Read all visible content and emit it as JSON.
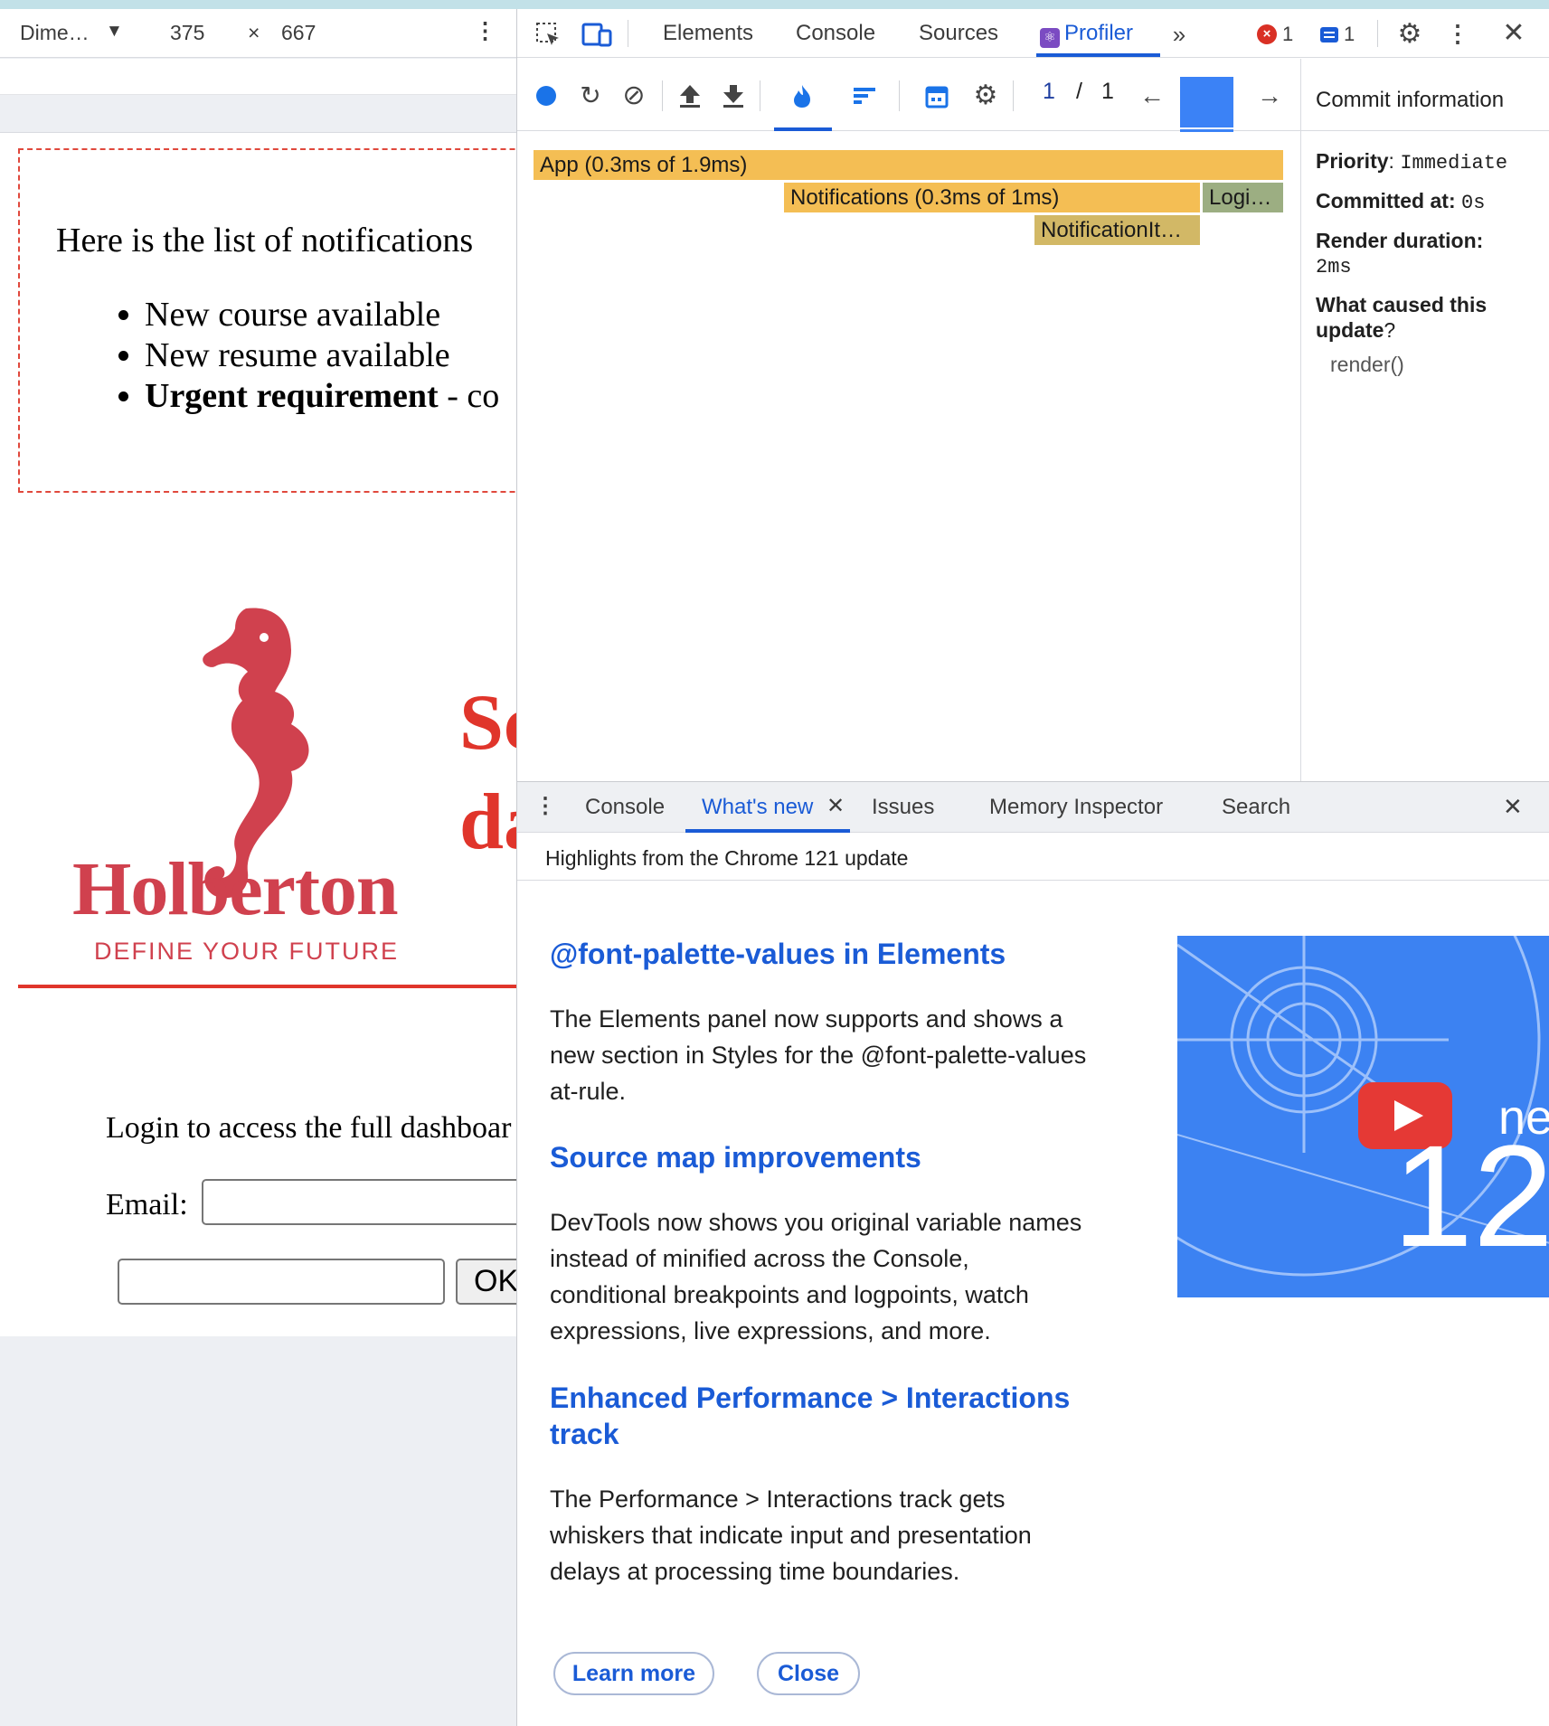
{
  "device_toolbar": {
    "dimensions": "Dime…",
    "width": "375",
    "times": "×",
    "height": "667"
  },
  "app": {
    "notifications_title": "Here is the list of notifications",
    "notifications": [
      {
        "text": "New course available"
      },
      {
        "text": "New resume available"
      },
      {
        "bold": "Urgent requirement",
        "text": " - co"
      }
    ],
    "brand": "Holberton",
    "tagline": "DEFINE YOUR FUTURE",
    "heading_line1": "Sc",
    "heading_line2": "da",
    "login_text": "Login to access the full dashboar",
    "email_label": "Email:",
    "ok_label": "OK"
  },
  "devtools": {
    "tabs": [
      "Elements",
      "Console",
      "Sources",
      "Profiler"
    ],
    "active_tab": "Profiler",
    "error_count": "1",
    "message_count": "1",
    "profiler": {
      "pager_current": "1",
      "pager_sep": "/",
      "pager_total": "1",
      "flame_bars": [
        {
          "label": "App (0.3ms of 1.9ms)",
          "color": "#f4be54"
        },
        {
          "label": "Notifications (0.3ms of 1ms)",
          "color": "#f4be54"
        },
        {
          "label": "Logi…",
          "color": "#9cae82"
        },
        {
          "label": "NotificationIt…",
          "color": "#d2b866"
        }
      ]
    },
    "commit_info": {
      "title": "Commit information",
      "priority_label": "Priority",
      "priority_value": "Immediate",
      "committed_label": "Committed at:",
      "committed_value": "0s",
      "render_label": "Render duration:",
      "render_value": "2ms",
      "cause_label_1": "What caused this",
      "cause_label_2": "update",
      "cause_value": "render()"
    },
    "drawer": {
      "tabs": [
        "Console",
        "What's new",
        "Issues",
        "Memory Inspector",
        "Search"
      ],
      "active_tab": "What's new",
      "highlights": "Highlights from the Chrome 121 update",
      "items": [
        {
          "title": "@font-palette-values in Elements",
          "body": "The Elements panel now supports and shows a new section in Styles for the @font-palette-values at-rule."
        },
        {
          "title": "Source map improvements",
          "body": "DevTools now shows you original variable names instead of minified across the Console, conditional breakpoints and logpoints, watch expressions, live expressions, and more."
        },
        {
          "title": "Enhanced Performance > Interactions track",
          "body": "The Performance > Interactions track gets whiskers that indicate input and presentation delays at processing time boundaries."
        }
      ],
      "thumb_text_1": "ne",
      "thumb_text_2": "12",
      "learn_more": "Learn more",
      "close": "Close"
    }
  },
  "colors": {
    "accent": "#1a5bd6",
    "brand_red": "#d0414e",
    "heading_red": "#e0352b",
    "commit_bar": "#3b82f6"
  }
}
